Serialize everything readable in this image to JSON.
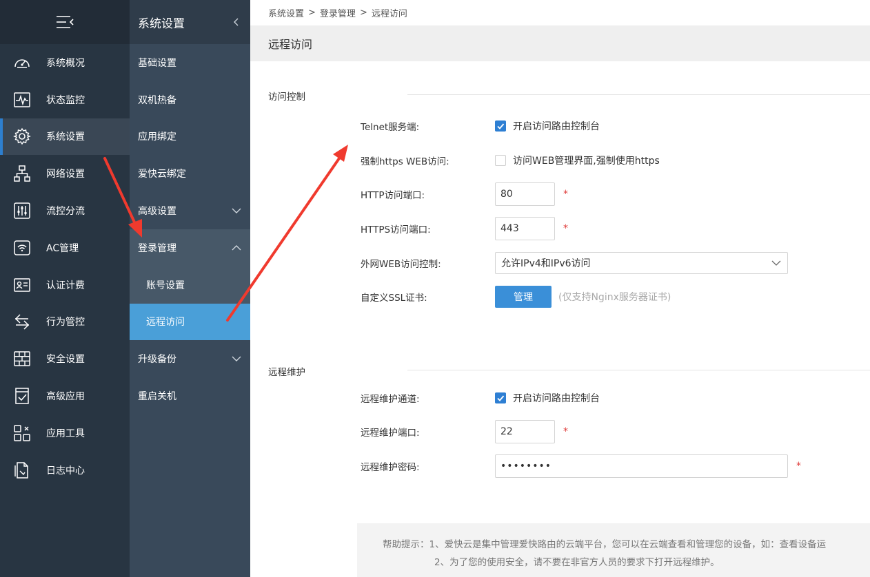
{
  "sidebar": {
    "items": [
      {
        "label": "系统概况",
        "icon": "speedometer-icon"
      },
      {
        "label": "状态监控",
        "icon": "pulse-monitor-icon"
      },
      {
        "label": "系统设置",
        "icon": "gear-icon"
      },
      {
        "label": "网络设置",
        "icon": "network-icon"
      },
      {
        "label": "流控分流",
        "icon": "sliders-icon"
      },
      {
        "label": "AC管理",
        "icon": "wifi-router-icon"
      },
      {
        "label": "认证计费",
        "icon": "id-card-icon"
      },
      {
        "label": "行为管控",
        "icon": "swap-arrows-icon"
      },
      {
        "label": "安全设置",
        "icon": "firewall-icon"
      },
      {
        "label": "高级应用",
        "icon": "checklist-icon"
      },
      {
        "label": "应用工具",
        "icon": "tools-grid-icon"
      },
      {
        "label": "日志中心",
        "icon": "document-icon"
      }
    ],
    "active_index": 2
  },
  "subnav": {
    "title": "系统设置",
    "items": [
      {
        "label": "基础设置"
      },
      {
        "label": "双机热备"
      },
      {
        "label": "应用绑定"
      },
      {
        "label": "爱快云绑定"
      },
      {
        "label": "高级设置"
      },
      {
        "label": "登录管理"
      },
      {
        "label": "账号设置"
      },
      {
        "label": "远程访问"
      },
      {
        "label": "升级备份"
      },
      {
        "label": "重启关机"
      }
    ]
  },
  "breadcrumb": {
    "parts": [
      "系统设置",
      "登录管理",
      "远程访问"
    ],
    "sep": ">"
  },
  "page_title": "远程访问",
  "access_control": {
    "heading": "访问控制",
    "telnet_label": "Telnet服务端:",
    "telnet_checked": true,
    "telnet_text": "开启访问路由控制台",
    "https_label": "强制https WEB访问:",
    "https_checked": false,
    "https_text": "访问WEB管理界面,强制使用https",
    "http_port_label": "HTTP访问端口:",
    "http_port": "80",
    "https_port_label": "HTTPS访问端口:",
    "https_port": "443",
    "required_mark": "*",
    "wan_label": "外网WEB访问控制:",
    "wan_value": "允许IPv4和IPv6访问",
    "ssl_label": "自定义SSL证书:",
    "ssl_button": "管理",
    "ssl_hint": "(仅支持Nginx服务器证书)"
  },
  "remote_maint": {
    "heading": "远程维护",
    "channel_label": "远程维护通道:",
    "channel_checked": true,
    "channel_text": "开启访问路由控制台",
    "port_label": "远程维护端口:",
    "port": "22",
    "password_label": "远程维护密码:",
    "password": "••••••••"
  },
  "help": {
    "line1": "帮助提示：1、爱快云是集中管理爱快路由的云端平台，您可以在云端查看和管理您的设备，如：查看设备运",
    "line2": "2、为了您的使用安全，请不要在非官方人员的要求下打开远程维护。"
  },
  "colors": {
    "accent": "#4a9fd8",
    "arrow": "#f03a2e",
    "checkbox": "#2e7fd3"
  }
}
